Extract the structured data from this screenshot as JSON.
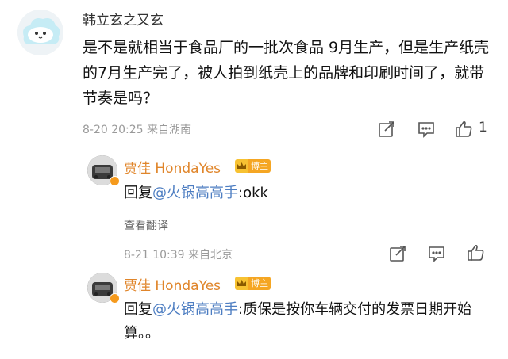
{
  "comment": {
    "author": "韩立玄之又玄",
    "text": "是不是就相当于食品厂的一批次食品 9月生产，但是生产纸壳的7月生产完了，被人拍到纸壳上的品牌和印刷时间了，就带节奏是吗？",
    "meta": "8-20 20:25  来自湖南",
    "like_count": "1"
  },
  "replies": [
    {
      "author": "贾佳 HondaYes",
      "badge": "博主",
      "prefix": "回复",
      "mention": "@火锅高高手",
      "content": ":okk",
      "translate": "查看翻译",
      "meta": "8-21 10:39  来自北京"
    },
    {
      "author": "贾佳 HondaYes",
      "badge": "博主",
      "prefix": "回复",
      "mention": "@火锅高高手",
      "content": ":质保是按你车辆交付的发票日期开始算。。"
    }
  ],
  "icons": [
    "share-icon",
    "comment-icon",
    "like-icon",
    "verified-icon",
    "crown-icon"
  ],
  "colors": {
    "author_orange": "#e0852a",
    "mention_blue": "#4e7ec2",
    "badge_orange": "#f5a623",
    "verified": "#f59a1d"
  }
}
